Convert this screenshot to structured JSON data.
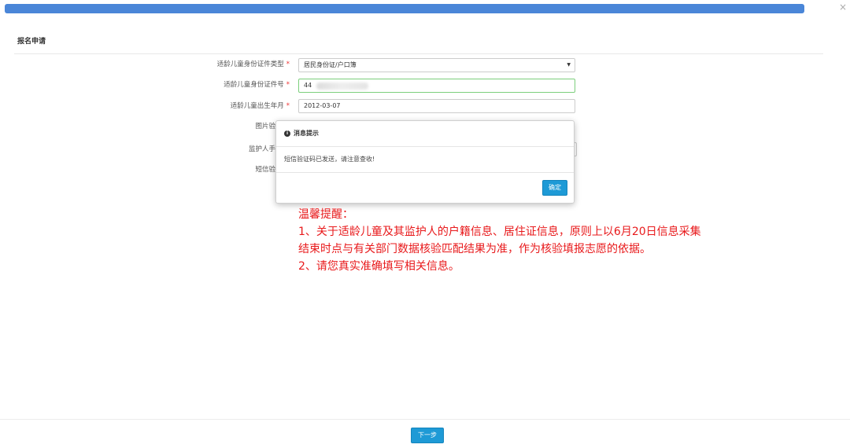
{
  "window": {
    "close_glyph": "×"
  },
  "page": {
    "title": "报名申请"
  },
  "form": {
    "required_mark": "*",
    "id_type": {
      "label": "适龄儿童身份证件类型",
      "value": "居民身份证/户口簿"
    },
    "id_number": {
      "label": "适龄儿童身份证件号",
      "value": "44"
    },
    "birth": {
      "label": "适龄儿童出生年月",
      "value": "2012-03-07"
    },
    "captcha": {
      "label": "图片验"
    },
    "guardian_phone": {
      "label": "监护人手"
    },
    "sms_code": {
      "label": "短信验"
    }
  },
  "dialog": {
    "title": "消息提示",
    "icon": "info-icon",
    "message": "短信验证码已发送，请注意查收!",
    "ok_label": "确定"
  },
  "tips": {
    "heading": "温馨提醒：",
    "line1": "1、关于适龄儿童及其监护人的户籍信息、居住证信息，原则上以6月20日信息采集结束时点与有关部门数据核验匹配结果为准，作为核验填报志愿的依据。",
    "line2": "2、请您真实准确填写相关信息。"
  },
  "footer": {
    "next_label": "下一步"
  },
  "colors": {
    "accent": "#1e9ad6",
    "tips": "#e8191b",
    "topbar": "#4a86d8"
  }
}
